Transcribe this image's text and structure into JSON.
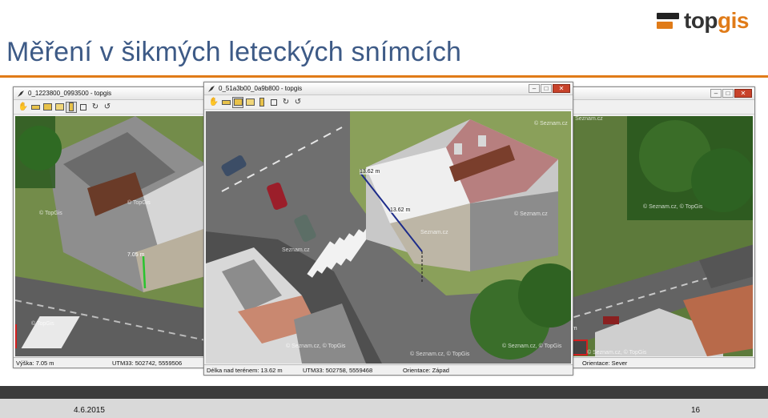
{
  "slide": {
    "title": "Měření v šikmých leteckých snímcích",
    "logo": {
      "part1": "top",
      "part2": "gis"
    },
    "date": "4.6.2015",
    "page_number": "16"
  },
  "colors": {
    "title": "#3d5a86",
    "accent": "#e07b18",
    "footer_dark": "#3b3b3b"
  },
  "window_left": {
    "title": "0_1223800_0993500 - topgis",
    "measure_label": "7.05 m",
    "status": {
      "height": "Výška: 7.05 m",
      "coords": "UTM33: 502742, 5559506"
    },
    "watermarks": [
      "© TopGis",
      "© TopGis",
      "© TopGis"
    ]
  },
  "window_center": {
    "title": "0_51a3b00_0a9b800 - topgis",
    "measure_label_1": "13.62 m",
    "measure_label_2": "13.62 m",
    "status": {
      "length": "Délka nad terénem: 13.62 m",
      "coords": "UTM33: 502758, 5559468",
      "orientation": "Orientace: Západ"
    },
    "watermarks": [
      "© Seznam.cz",
      "Seznam.cz",
      "© Seznam.cz, © TopGis",
      "© Seznam.cz, © TopGis",
      "© Seznam.cz, © TopGis",
      "© Seznam.cz",
      "Seznam.cz"
    ]
  },
  "window_right": {
    "status": {
      "orientation": "Orientace: Sever"
    },
    "measure_label": "35 m",
    "watermarks": [
      "© Seznam.cz",
      "© Seznam.cz, © TopGis",
      "© Seznam.cz, © TopGis"
    ]
  },
  "toolbar_icons": [
    "hand-icon",
    "ruler-icon",
    "area-icon",
    "height-icon",
    "vertical-icon",
    "frame-icon",
    "rotate-icon",
    "undo-icon"
  ]
}
